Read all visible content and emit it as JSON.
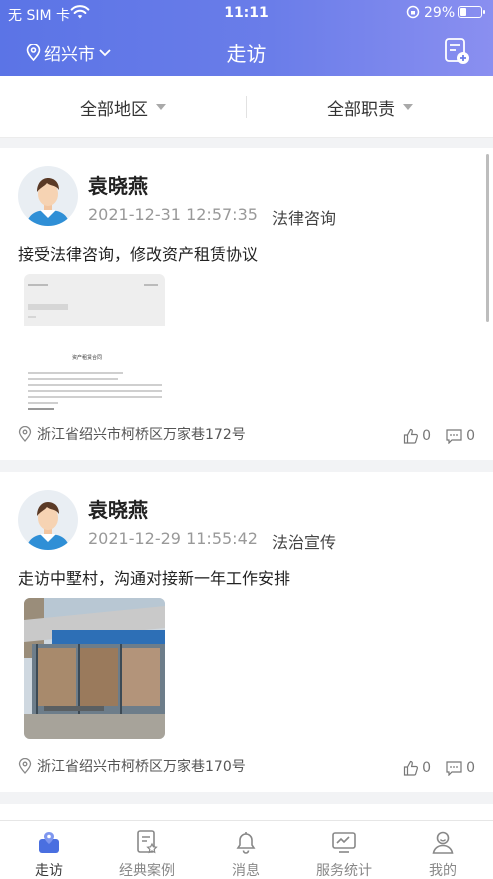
{
  "status_bar": {
    "carrier": "无 SIM 卡",
    "time": "11:11",
    "battery": "29%",
    "battery_level": 0.29
  },
  "nav": {
    "city": "绍兴市",
    "title": "走访"
  },
  "filters": {
    "region": "全部地区",
    "duty": "全部职责"
  },
  "visits": [
    {
      "name": "袁晓燕",
      "datetime": "2021-12-31 12:57:35",
      "category": "法律咨询",
      "description": "接受法律咨询，修改资产租赁协议",
      "doc_title": "资产租赁合同",
      "address": "浙江省绍兴市柯桥区万家巷172号",
      "likes": "0",
      "comments": "0"
    },
    {
      "name": "袁晓燕",
      "datetime": "2021-12-29 11:55:42",
      "category": "法治宣传",
      "description": "走访中墅村，沟通对接新一年工作安排",
      "address": "浙江省绍兴市柯桥区万家巷170号",
      "likes": "0",
      "comments": "0"
    }
  ],
  "tabs": [
    {
      "label": "走访",
      "icon": "visit-icon",
      "active": true
    },
    {
      "label": "经典案例",
      "icon": "case-icon"
    },
    {
      "label": "消息",
      "icon": "bell-icon"
    },
    {
      "label": "服务统计",
      "icon": "monitor-icon"
    },
    {
      "label": "我的",
      "icon": "user-icon"
    }
  ],
  "colors": {
    "accent": "#5b74e6",
    "tab_active": "#4a6fe0"
  }
}
